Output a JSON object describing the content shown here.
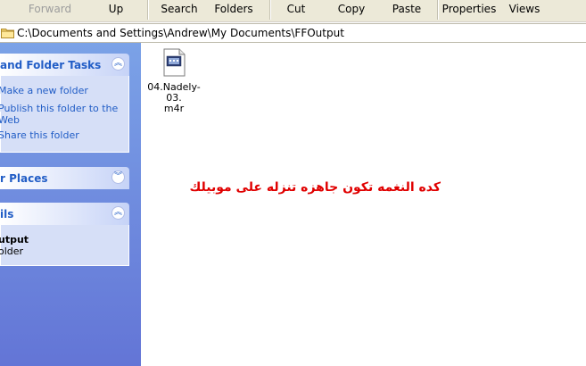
{
  "toolbar": {
    "forward": "Forward",
    "up": "Up",
    "search": "Search",
    "folders": "Folders",
    "cut": "Cut",
    "copy": "Copy",
    "paste": "Paste",
    "properties": "Properties",
    "views": "Views"
  },
  "address": {
    "path": "C:\\Documents and Settings\\Andrew\\My Documents\\FFOutput",
    "icon": "folder-icon"
  },
  "left_pane": {
    "file_folder_tasks": {
      "title": "and Folder Tasks",
      "toggle": "collapse",
      "items": [
        {
          "label": "Make a new folder"
        },
        {
          "label_line1": "Publish this folder to the",
          "label_line2": "Web"
        },
        {
          "label": "Share this folder"
        }
      ]
    },
    "other_places": {
      "title": "r Places",
      "toggle": "expand"
    },
    "details": {
      "title": "ils",
      "toggle": "collapse",
      "name": "utput",
      "type": "older"
    }
  },
  "main": {
    "file": {
      "name_line1": "04.Nadely-03.",
      "name_line2": "m4r",
      "icon": "media-file-icon"
    },
    "annotation": "كده النغمه تكون جاهزه تنزله على موبيلك",
    "annotation_color": "#e00000"
  },
  "colors": {
    "toolbar_bg": "#ece9d8",
    "taskpane_gradient_top": "#7ba2e7",
    "taskpane_gradient_bottom": "#6375d6",
    "panel_body": "#d6dff7",
    "link": "#215dc6"
  }
}
